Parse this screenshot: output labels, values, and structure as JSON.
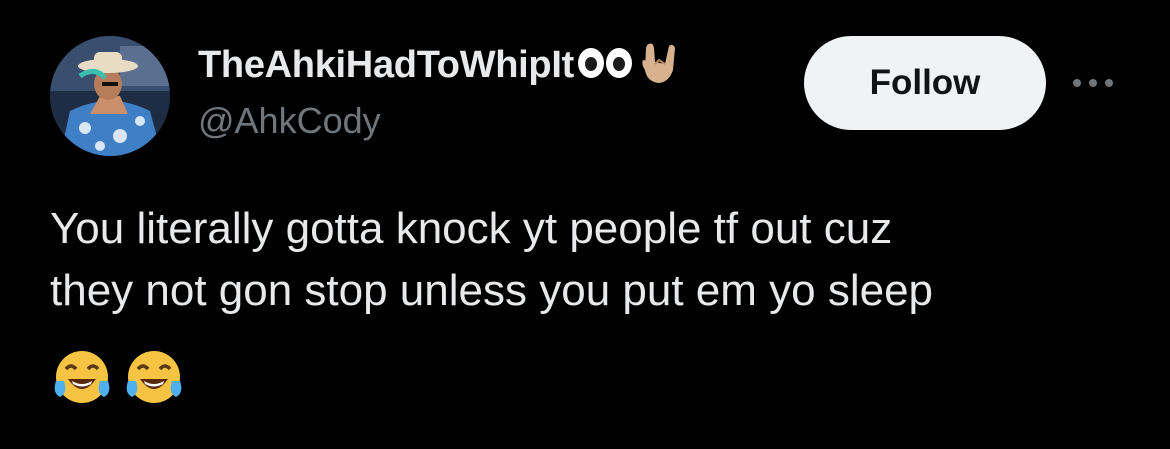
{
  "user": {
    "display_name": "TheAhkiHadToWhipIt",
    "handle": "@AhkCody",
    "avatar": "avatar-photo",
    "name_emojis": [
      "eyes-icon",
      "rock-on-hand-icon"
    ]
  },
  "actions": {
    "follow_label": "Follow",
    "more_icon": "more-icon"
  },
  "tweet": {
    "text": "You literally gotta knock yt people tf out cuz\nthey not gon stop unless you put em yo sleep",
    "emojis": [
      "tears-of-joy-icon",
      "tears-of-joy-icon"
    ]
  },
  "colors": {
    "background": "#000000",
    "text": "#e7e9ea",
    "secondary_text": "#71767b",
    "follow_bg": "#eff3f4",
    "follow_text": "#0f1419"
  }
}
